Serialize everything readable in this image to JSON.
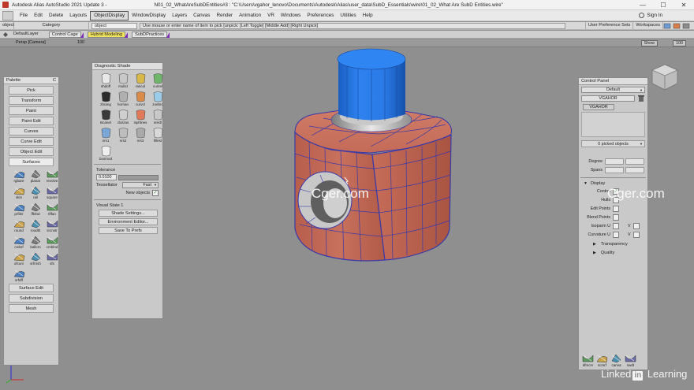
{
  "window": {
    "title": "Autodesk Alias AutoStudio 2021 Update 3 -",
    "file_title": "N01_02_WhatAreSubDEntities#3 : \"C:\\Users\\vgahor_lenovo\\Documents\\Autodesk\\Alias\\user_data\\SubD_Essentials\\wire\\01_02_What Are SubD Entities.wire\"",
    "min_glyph": "—",
    "max_glyph": "☐",
    "close_glyph": "✕"
  },
  "menu": {
    "items": [
      "File",
      "Edit",
      "Delete",
      "Layouts",
      "ObjectDisplay",
      "WindowDisplay",
      "Layers",
      "Canvas",
      "Render",
      "Animation",
      "VR",
      "Windows",
      "Preferences",
      "Utilities",
      "Help"
    ],
    "active_index": 4,
    "sign_in": "Sign In"
  },
  "toolbar1": {
    "object_label": "object",
    "category_label": "Category",
    "object_field": "object",
    "prompt": "Use mouse or enter name of item to pick [unpick: [Left Toggle] [Middle Add] [Right Unpick]",
    "user_pref_sets": "User Preference Sets",
    "workspaces": "Workspaces"
  },
  "toolbar2": {
    "default_layer": "DefaultLayer",
    "control_cage": "Control Cage",
    "hybrid_modeling": "Hybrid Modeling",
    "subd_practices": "SubDPractices"
  },
  "ruler": {
    "view_label": "Persp [Camera]  ",
    "zoom": "100",
    "show": "Show",
    "scale": "100"
  },
  "palette": {
    "title": "Palette",
    "close_glyph": "C",
    "top_buttons": [
      "Pick",
      "Transform",
      "Paint",
      "Paint Edit",
      "Curves",
      "Curve Edit",
      "Object Edit",
      "Surfaces"
    ],
    "surface_tools": [
      "rgbare",
      "planar",
      "revolve",
      "skin",
      "rail",
      "square",
      "prfiler",
      "ffblnd",
      "tflfan",
      "round",
      "roudth",
      "srcnstr",
      "crdsrf",
      "ballcrn",
      "crnblnd",
      "ofcurv",
      "srfrnsh",
      "sfs",
      "srfdff"
    ],
    "bottom_buttons": [
      "Surface Edit",
      "Subdivision",
      "Mesh"
    ]
  },
  "diagnostic": {
    "title": "Diagnostic Shade",
    "shaders": [
      "shdoff",
      "multcl",
      "rancol",
      "curevl",
      "zbrang",
      "hornan",
      "curvcl",
      "zoebrc",
      "Bcanel",
      "clarzas",
      "isphtnes",
      "srecll",
      "nrs1",
      "nrs2",
      "nrs3",
      "fillest",
      "bosmod"
    ],
    "tolerance_label": "Tolerance",
    "tolerance_value": "0.0100",
    "tessellator_label": "Tessellator",
    "tessellator_value": "Fast",
    "new_objects_label": "New objects",
    "visual_state": "Visual State 1",
    "buttons": [
      "Shade Settings...",
      "Environment Editor...",
      "Save To Prefs"
    ]
  },
  "control_panel": {
    "title": "Control Panel",
    "preset": "Default",
    "name_field": "VGAHOR",
    "tab": "VGAHOR",
    "picked": "0 picked objects",
    "degree_label": "Degree",
    "spans_label": "Spans",
    "display_label": "Display",
    "rows": [
      "Control",
      "Hulls",
      "Edit Points",
      "Blend Points",
      "Isoparm U",
      "Curvature U"
    ],
    "v_label": "V",
    "transparency": "Transparency",
    "quality": "Quality",
    "bottom_tools": [
      "dfmcrv",
      "scrsrf",
      "canva",
      "swdt"
    ]
  },
  "watermarks": {
    "left": "Cger.com",
    "right": "Cger.com",
    "linkedin_a": "Linked",
    "linkedin_in": "in",
    "linkedin_b": " Learning"
  },
  "colors": {
    "viewport_bg": "#8f8f8f",
    "subd_body": "#c46b58",
    "cage_lines": "#3a39a8",
    "cylinder_top": "#1f73e8",
    "highlight": "#f4e65c"
  }
}
